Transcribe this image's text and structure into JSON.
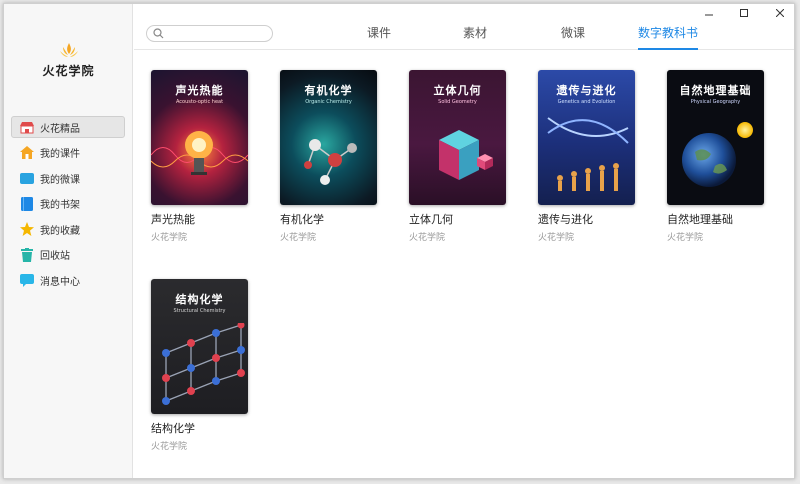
{
  "app": {
    "name": "火花学院"
  },
  "sidebar": {
    "items": [
      {
        "label": "火花精品",
        "icon": "store-icon"
      },
      {
        "label": "我的课件",
        "icon": "home-icon"
      },
      {
        "label": "我的微课",
        "icon": "folder-icon"
      },
      {
        "label": "我的书架",
        "icon": "book-icon"
      },
      {
        "label": "我的收藏",
        "icon": "star-icon"
      },
      {
        "label": "回收站",
        "icon": "trash-icon"
      },
      {
        "label": "消息中心",
        "icon": "message-icon"
      }
    ],
    "active_index": 0
  },
  "search": {
    "placeholder": ""
  },
  "tabs": [
    {
      "label": "课件"
    },
    {
      "label": "素材"
    },
    {
      "label": "微课"
    },
    {
      "label": "数字教科书"
    }
  ],
  "active_tab": 3,
  "books": [
    {
      "title": "声光热能",
      "publisher": "火花学院",
      "cover_title": "声光热能",
      "cover_sub": "Acousto-optic heat"
    },
    {
      "title": "有机化学",
      "publisher": "火花学院",
      "cover_title": "有机化学",
      "cover_sub": "Organic Chemistry"
    },
    {
      "title": "立体几何",
      "publisher": "火花学院",
      "cover_title": "立体几何",
      "cover_sub": "Solid Geometry"
    },
    {
      "title": "遗传与进化",
      "publisher": "火花学院",
      "cover_title": "遗传与进化",
      "cover_sub": "Genetics and Evolution"
    },
    {
      "title": "自然地理基础",
      "publisher": "火花学院",
      "cover_title": "自然地理基础",
      "cover_sub": "Physical Geography"
    },
    {
      "title": "结构化学",
      "publisher": "火花学院",
      "cover_title": "结构化学",
      "cover_sub": "Structural Chemistry"
    }
  ],
  "colors": {
    "accent": "#1e88e5"
  }
}
